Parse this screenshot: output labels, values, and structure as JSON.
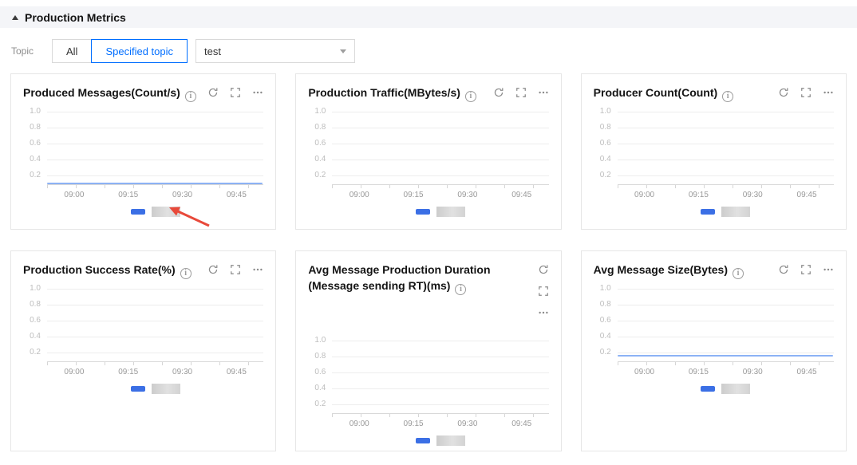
{
  "header": {
    "title": "Production Metrics"
  },
  "filter": {
    "label": "Topic",
    "segments": [
      {
        "label": "All",
        "selected": false
      },
      {
        "label": "Specified topic",
        "selected": true
      }
    ],
    "topic_select": {
      "value": "test"
    }
  },
  "axes": {
    "y": [
      "1.0",
      "0.8",
      "0.6",
      "0.4",
      "0.2"
    ],
    "x": [
      "09:00",
      "09:15",
      "09:30",
      "09:45"
    ]
  },
  "cards": [
    {
      "title": "Produced Messages(Count/s)"
    },
    {
      "title": "Production Traffic(MBytes/s)"
    },
    {
      "title": "Producer Count(Count)"
    },
    {
      "title": "Production Success Rate(%)"
    },
    {
      "title": "Avg Message Production Duration (Message sending RT)(ms)"
    },
    {
      "title": "Avg Message Size(Bytes)"
    }
  ],
  "colors": {
    "accent": "#006eff",
    "legend_series": "#3b6fe5",
    "series_line": "#8cb2f5",
    "annotation_arrow": "#e8493a",
    "section_header_bg": "#f4f5f8"
  },
  "chart_data": [
    {
      "type": "line",
      "title": "Produced Messages(Count/s)",
      "x_ticks": [
        "09:00",
        "09:15",
        "09:30",
        "09:45"
      ],
      "y_ticks": [
        0.2,
        0.4,
        0.6,
        0.8,
        1.0
      ],
      "ylim": [
        0,
        1
      ],
      "grid": true,
      "legend_position": "bottom",
      "legend_redacted": true,
      "series": [
        {
          "name": "",
          "values": [
            0,
            0,
            0,
            0
          ]
        }
      ]
    },
    {
      "type": "line",
      "title": "Production Traffic(MBytes/s)",
      "x_ticks": [
        "09:00",
        "09:15",
        "09:30",
        "09:45"
      ],
      "y_ticks": [
        0.2,
        0.4,
        0.6,
        0.8,
        1.0
      ],
      "ylim": [
        0,
        1
      ],
      "grid": true,
      "legend_position": "bottom",
      "legend_redacted": true,
      "series": []
    },
    {
      "type": "line",
      "title": "Producer Count(Count)",
      "x_ticks": [
        "09:00",
        "09:15",
        "09:30",
        "09:45"
      ],
      "y_ticks": [
        0.2,
        0.4,
        0.6,
        0.8,
        1.0
      ],
      "ylim": [
        0,
        1
      ],
      "grid": true,
      "legend_position": "bottom",
      "legend_redacted": true,
      "series": []
    },
    {
      "type": "line",
      "title": "Production Success Rate(%)",
      "x_ticks": [
        "09:00",
        "09:15",
        "09:30",
        "09:45"
      ],
      "y_ticks": [
        0.2,
        0.4,
        0.6,
        0.8,
        1.0
      ],
      "ylim": [
        0,
        1
      ],
      "grid": true,
      "legend_position": "bottom",
      "legend_redacted": true,
      "series": []
    },
    {
      "type": "line",
      "title": "Avg Message Production Duration (Message sending RT)(ms)",
      "x_ticks": [
        "09:00",
        "09:15",
        "09:30",
        "09:45"
      ],
      "y_ticks": [
        0.2,
        0.4,
        0.6,
        0.8,
        1.0
      ],
      "ylim": [
        0,
        1
      ],
      "grid": true,
      "legend_position": "bottom",
      "legend_redacted": true,
      "series": []
    },
    {
      "type": "line",
      "title": "Avg Message Size(Bytes)",
      "x_ticks": [
        "09:00",
        "09:15",
        "09:30",
        "09:45"
      ],
      "y_ticks": [
        0.2,
        0.4,
        0.6,
        0.8,
        1.0
      ],
      "ylim": [
        0,
        1
      ],
      "grid": true,
      "legend_position": "bottom",
      "legend_redacted": true,
      "series": [
        {
          "name": "",
          "values": [
            0.05,
            0.05,
            0.05,
            0.05
          ]
        }
      ]
    }
  ]
}
